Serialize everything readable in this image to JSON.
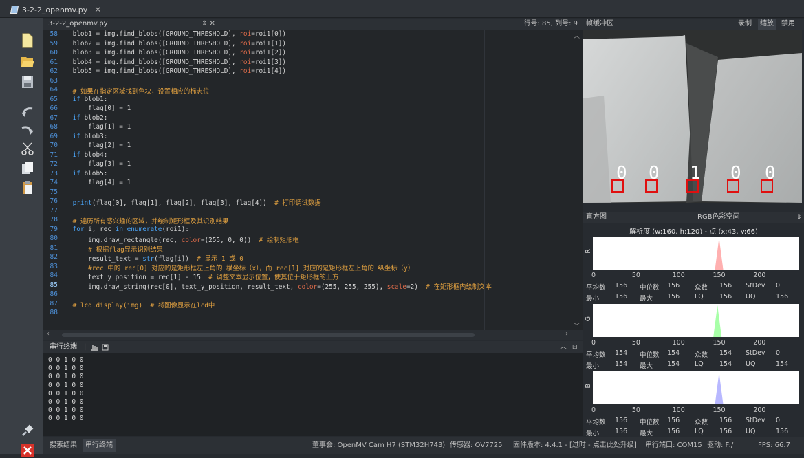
{
  "window_tab": "3-2-2_openmv.py",
  "editor": {
    "file_name": "3-2-2_openmv.py",
    "position": "行号: 85, 列号: 9",
    "lines": [
      {
        "n": "58",
        "html": "    blob1 = img.find_blobs([GROUND_THRESHOLD], <span class=\"st\">roi</span>=roi1[0])"
      },
      {
        "n": "59",
        "html": "    blob2 = img.find_blobs([GROUND_THRESHOLD], <span class=\"st\">roi</span>=roi1[1])"
      },
      {
        "n": "60",
        "html": "    blob3 = img.find_blobs([GROUND_THRESHOLD], <span class=\"st\">roi</span>=roi1[2])"
      },
      {
        "n": "61",
        "html": "    blob4 = img.find_blobs([GROUND_THRESHOLD], <span class=\"st\">roi</span>=roi1[3])"
      },
      {
        "n": "62",
        "html": "    blob5 = img.find_blobs([GROUND_THRESHOLD], <span class=\"st\">roi</span>=roi1[4])"
      },
      {
        "n": "63",
        "html": ""
      },
      {
        "n": "64",
        "html": "    <span class=\"cm\"># 如果在指定区域找到色块，设置相应的标志位</span>"
      },
      {
        "n": "65",
        "html": "    <span class=\"kw\">if</span> blob1:"
      },
      {
        "n": "66",
        "html": "        flag[0] = 1"
      },
      {
        "n": "67",
        "html": "    <span class=\"kw\">if</span> blob2:"
      },
      {
        "n": "68",
        "html": "        flag[1] = 1"
      },
      {
        "n": "69",
        "html": "    <span class=\"kw\">if</span> blob3:"
      },
      {
        "n": "70",
        "html": "        flag[2] = 1"
      },
      {
        "n": "71",
        "html": "    <span class=\"kw\">if</span> blob4:"
      },
      {
        "n": "72",
        "html": "        flag[3] = 1"
      },
      {
        "n": "73",
        "html": "    <span class=\"kw\">if</span> blob5:"
      },
      {
        "n": "74",
        "html": "        flag[4] = 1"
      },
      {
        "n": "75",
        "html": ""
      },
      {
        "n": "76",
        "html": "    <span class=\"kw\">print</span>(flag[0], flag[1], flag[2], flag[3], flag[4])  <span class=\"cm\"># 打印调试数据</span>"
      },
      {
        "n": "77",
        "html": ""
      },
      {
        "n": "78",
        "html": "    <span class=\"cm\"># 遍历所有感兴趣的区域，并绘制矩形框及其识别结果</span>"
      },
      {
        "n": "79",
        "html": "    <span class=\"kw\">for</span> i, rec <span class=\"kw\">in</span> <span class=\"kw\">enumerate</span>(roi1):"
      },
      {
        "n": "80",
        "html": "        img.draw_rectangle(rec, <span class=\"st\">color</span>=(255, 0, 0))  <span class=\"cm\"># 绘制矩形框</span>"
      },
      {
        "n": "81",
        "html": "        <span class=\"cm\"># 根据flag显示识别结果</span>"
      },
      {
        "n": "82",
        "html": "        result_text = <span class=\"kw\">str</span>(flag[i])  <span class=\"cm\"># 显示 1 或 0</span>"
      },
      {
        "n": "83",
        "html": "        <span class=\"cm\">#rec 中的 rec[0] 对应的是矩形框左上角的 横坐标（x），而 rec[1] 对应的是矩形框左上角的 纵坐标（y）</span>"
      },
      {
        "n": "84",
        "html": "        text_y_position = rec[1] - 15  <span class=\"cm\"># 调整文本显示位置，使其位于矩形框的上方</span>"
      },
      {
        "n": "85",
        "html": "        img.draw_string(rec[0], text_y_position, result_text, <span class=\"st\">color</span>=(255, 255, 255), <span class=\"st\">scale</span>=2)  <span class=\"cm\"># 在矩形框内绘制文本</span>"
      },
      {
        "n": "86",
        "html": ""
      },
      {
        "n": "87",
        "html": "    <span class=\"cm\"># lcd.display(img)  # 将图像显示在lcd中</span>"
      },
      {
        "n": "88",
        "html": ""
      }
    ]
  },
  "terminal": {
    "title": "串行终端",
    "lines": [
      "0 0 1 0 0",
      "0 0 1 0 0",
      "0 0 1 0 0",
      "0 0 1 0 0",
      "0 0 1 0 0",
      "0 0 1 0 0",
      "0 0 1 0 0",
      "0 0 1 0 0"
    ]
  },
  "framebuffer": {
    "title": "帧缓冲区",
    "buttons": [
      "录制",
      "缩放",
      "禁用"
    ],
    "digits": [
      "0",
      "0",
      "1",
      "0",
      "0"
    ]
  },
  "histogram": {
    "title": "直方图",
    "colorspace": "RGB色彩空间",
    "resolution": "解析度 (w:160, h:120) - 点 (x:43, y:66)",
    "ticks": [
      "0",
      "50",
      "100",
      "150",
      "200"
    ],
    "channels": [
      {
        "name": "R",
        "color": "#ffb0b0",
        "peak": 156,
        "mean": "156",
        "median": "156",
        "mode": "156",
        "stdev": "0",
        "min": "156",
        "max": "156",
        "lq": "156",
        "uq": "156"
      },
      {
        "name": "G",
        "color": "#a8ffa8",
        "peak": 154,
        "mean": "154",
        "median": "154",
        "mode": "154",
        "stdev": "0",
        "min": "154",
        "max": "154",
        "lq": "154",
        "uq": "154"
      },
      {
        "name": "B",
        "color": "#b8b8ff",
        "peak": 156,
        "mean": "156",
        "median": "156",
        "mode": "156",
        "stdev": "0",
        "min": "156",
        "max": "156",
        "lq": "156",
        "uq": "156"
      }
    ],
    "labels": {
      "mean": "平均数",
      "median": "中位数",
      "mode": "众数",
      "stdev": "StDev",
      "min": "最小",
      "max": "最大",
      "lq": "LQ",
      "uq": "UQ"
    }
  },
  "statusbar": {
    "search_results": "搜索结果",
    "serial_terminal": "串行终端",
    "board": "董事会: OpenMV Cam H7 (STM32H743)",
    "sensor": "传感器: OV7725",
    "firmware": "固件版本: 4.4.1 - [过时 - 点击此处升级]",
    "port": "串行端口: COM15",
    "drive": "驱动: F:/",
    "fps": "FPS: 66.7"
  }
}
